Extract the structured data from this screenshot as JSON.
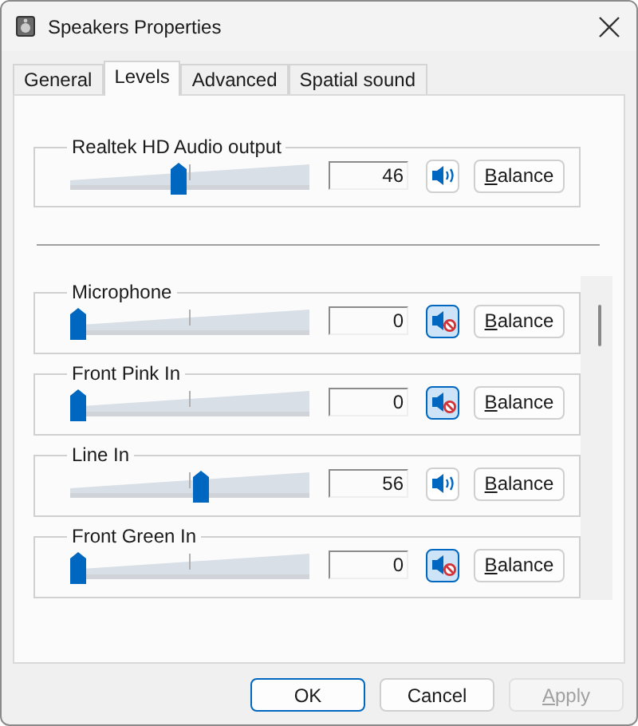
{
  "window": {
    "title": "Speakers Properties"
  },
  "tabs": [
    {
      "label": "General",
      "selected": false
    },
    {
      "label": "Levels",
      "selected": true
    },
    {
      "label": "Advanced",
      "selected": false
    },
    {
      "label": "Spatial sound",
      "selected": false
    }
  ],
  "master": {
    "name": "Realtek HD Audio output",
    "value": "46",
    "level": 0.46,
    "muted": false,
    "balance": "Balance"
  },
  "channels": [
    {
      "name": "Microphone",
      "value": "0",
      "level": 0,
      "muted": true,
      "balance": "Balance"
    },
    {
      "name": "Front Pink In",
      "value": "0",
      "level": 0,
      "muted": true,
      "balance": "Balance"
    },
    {
      "name": "Line In",
      "value": "56",
      "level": 0.56,
      "muted": false,
      "balance": "Balance"
    },
    {
      "name": "Front Green In",
      "value": "0",
      "level": 0,
      "muted": true,
      "balance": "Balance"
    }
  ],
  "buttons": [
    {
      "label": "OK",
      "disabled": false,
      "default": true
    },
    {
      "label": "Cancel",
      "disabled": false,
      "default": false
    },
    {
      "label": "Apply",
      "disabled": true,
      "default": false
    }
  ]
}
